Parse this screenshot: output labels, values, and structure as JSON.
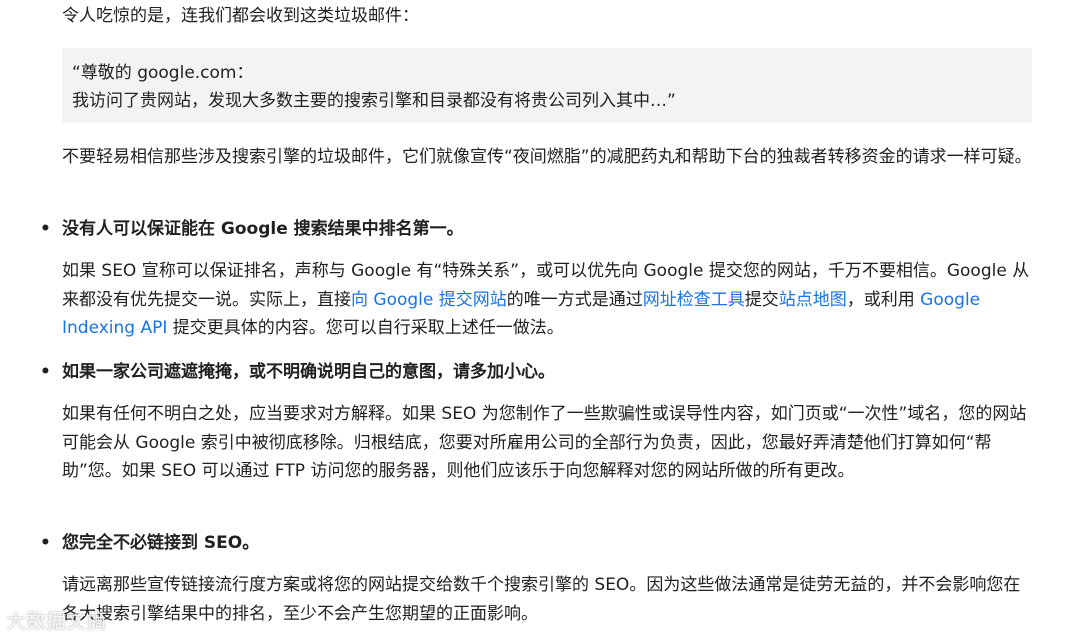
{
  "intro": "令人吃惊的是，连我们都会收到这类垃圾邮件：",
  "quote": {
    "line1": "“尊敬的 google.com：",
    "line2": "我访问了贵网站，发现大多数主要的搜索引擎和目录都没有将贵公司列入其中…”"
  },
  "para1": "不要轻易相信那些涉及搜索引擎的垃圾邮件，它们就像宣传“夜间燃脂”的减肥药丸和帮助下台的独裁者转移资金的请求一样可疑。",
  "bullets": [
    {
      "title": "没有人可以保证能在 Google 搜索结果中排名第一。",
      "text_parts": [
        "如果 SEO 宣称可以保证排名，声称与 Google 有“特殊关系”，或可以优先向 Google 提交您的网站，千万不要相信。Google 从来都没有优先提交一说。实际上，直接",
        "提交",
        "的唯一方式是通过",
        "提交",
        "，或利用 ",
        " 提交更具体的内容。您可以自行采取上述任一做法。"
      ],
      "links": {
        "submit_site": "向 Google 提交网站",
        "url_inspection": "网址检查工具",
        "sitemap": "站点地图",
        "indexing_api": "Google Indexing API"
      }
    },
    {
      "title": "如果一家公司遮遮掩掩，或不明确说明自己的意图，请多加小心。",
      "text": "如果有任何不明白之处，应当要求对方解释。如果 SEO 为您制作了一些欺骗性或误导性内容，如门页或“一次性”域名，您的网站可能会从 Google 索引中被彻底移除。归根结底，您要对所雇用公司的全部行为负责，因此，您最好弄清楚他们打算如何“帮助”您。如果 SEO 可以通过 FTP 访问您的服务器，则他们应该乐于向您解释对您的网站所做的所有更改。"
    },
    {
      "title": "您完全不必链接到 SEO。",
      "text": "请远离那些宣传链接流行度方案或将您的网站提交给数千个搜索引擎的 SEO。因为这些做法通常是徒劳无益的，并不会影响您在各大搜索引擎结果中的排名，至少不会产生您期望的正面影响。"
    }
  ],
  "watermark": "大数据文摘",
  "colors": {
    "text": "#202124",
    "link": "#1a73e8",
    "quote_bg": "#f1f3f4"
  }
}
